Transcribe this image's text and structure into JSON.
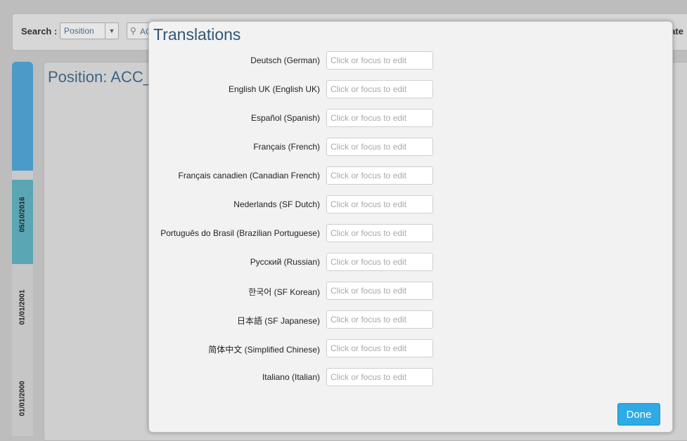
{
  "background": {
    "search_label": "Search :",
    "search_type_value": "Position",
    "search_text": "AC",
    "right_cutoff_label": "eate",
    "panel_title": "Position: ACC_",
    "timeline_dates": [
      "05/10/2016",
      "01/01/2001",
      "01/01/2000"
    ],
    "colors": {
      "timeline_blue": "#4c9ac7",
      "timeline_teal": "#5aa6b4",
      "title_blue": "#3d6483"
    }
  },
  "modal": {
    "title": "Translations",
    "rows": [
      {
        "label": "Deutsch (German)",
        "value": "",
        "placeholder": "Click or focus to edit"
      },
      {
        "label": "English UK (English UK)",
        "value": "",
        "placeholder": "Click or focus to edit"
      },
      {
        "label": "Español (Spanish)",
        "value": "",
        "placeholder": "Click or focus to edit"
      },
      {
        "label": "Français (French)",
        "value": "",
        "placeholder": "Click or focus to edit"
      },
      {
        "label": "Français canadien (Canadian French)",
        "value": "",
        "placeholder": "Click or focus to edit"
      },
      {
        "label": "Nederlands (SF Dutch)",
        "value": "",
        "placeholder": "Click or focus to edit"
      },
      {
        "label": "Português do Brasil (Brazilian Portuguese)",
        "value": "",
        "placeholder": "Click or focus to edit"
      },
      {
        "label": "Русский (Russian)",
        "value": "",
        "placeholder": "Click or focus to edit"
      },
      {
        "label": "한국어 (SF Korean)",
        "value": "",
        "placeholder": "Click or focus to edit"
      },
      {
        "label": "日本語 (SF Japanese)",
        "value": "",
        "placeholder": "Click or focus to edit"
      },
      {
        "label": "简体中文 (Simplified Chinese)",
        "value": "",
        "placeholder": "Click or focus to edit"
      },
      {
        "label": "Italiano (Italian)",
        "value": "",
        "placeholder": "Click or focus to edit"
      }
    ],
    "done_label": "Done",
    "colors": {
      "done_button": "#2eaae5",
      "title": "#2f5676"
    }
  }
}
